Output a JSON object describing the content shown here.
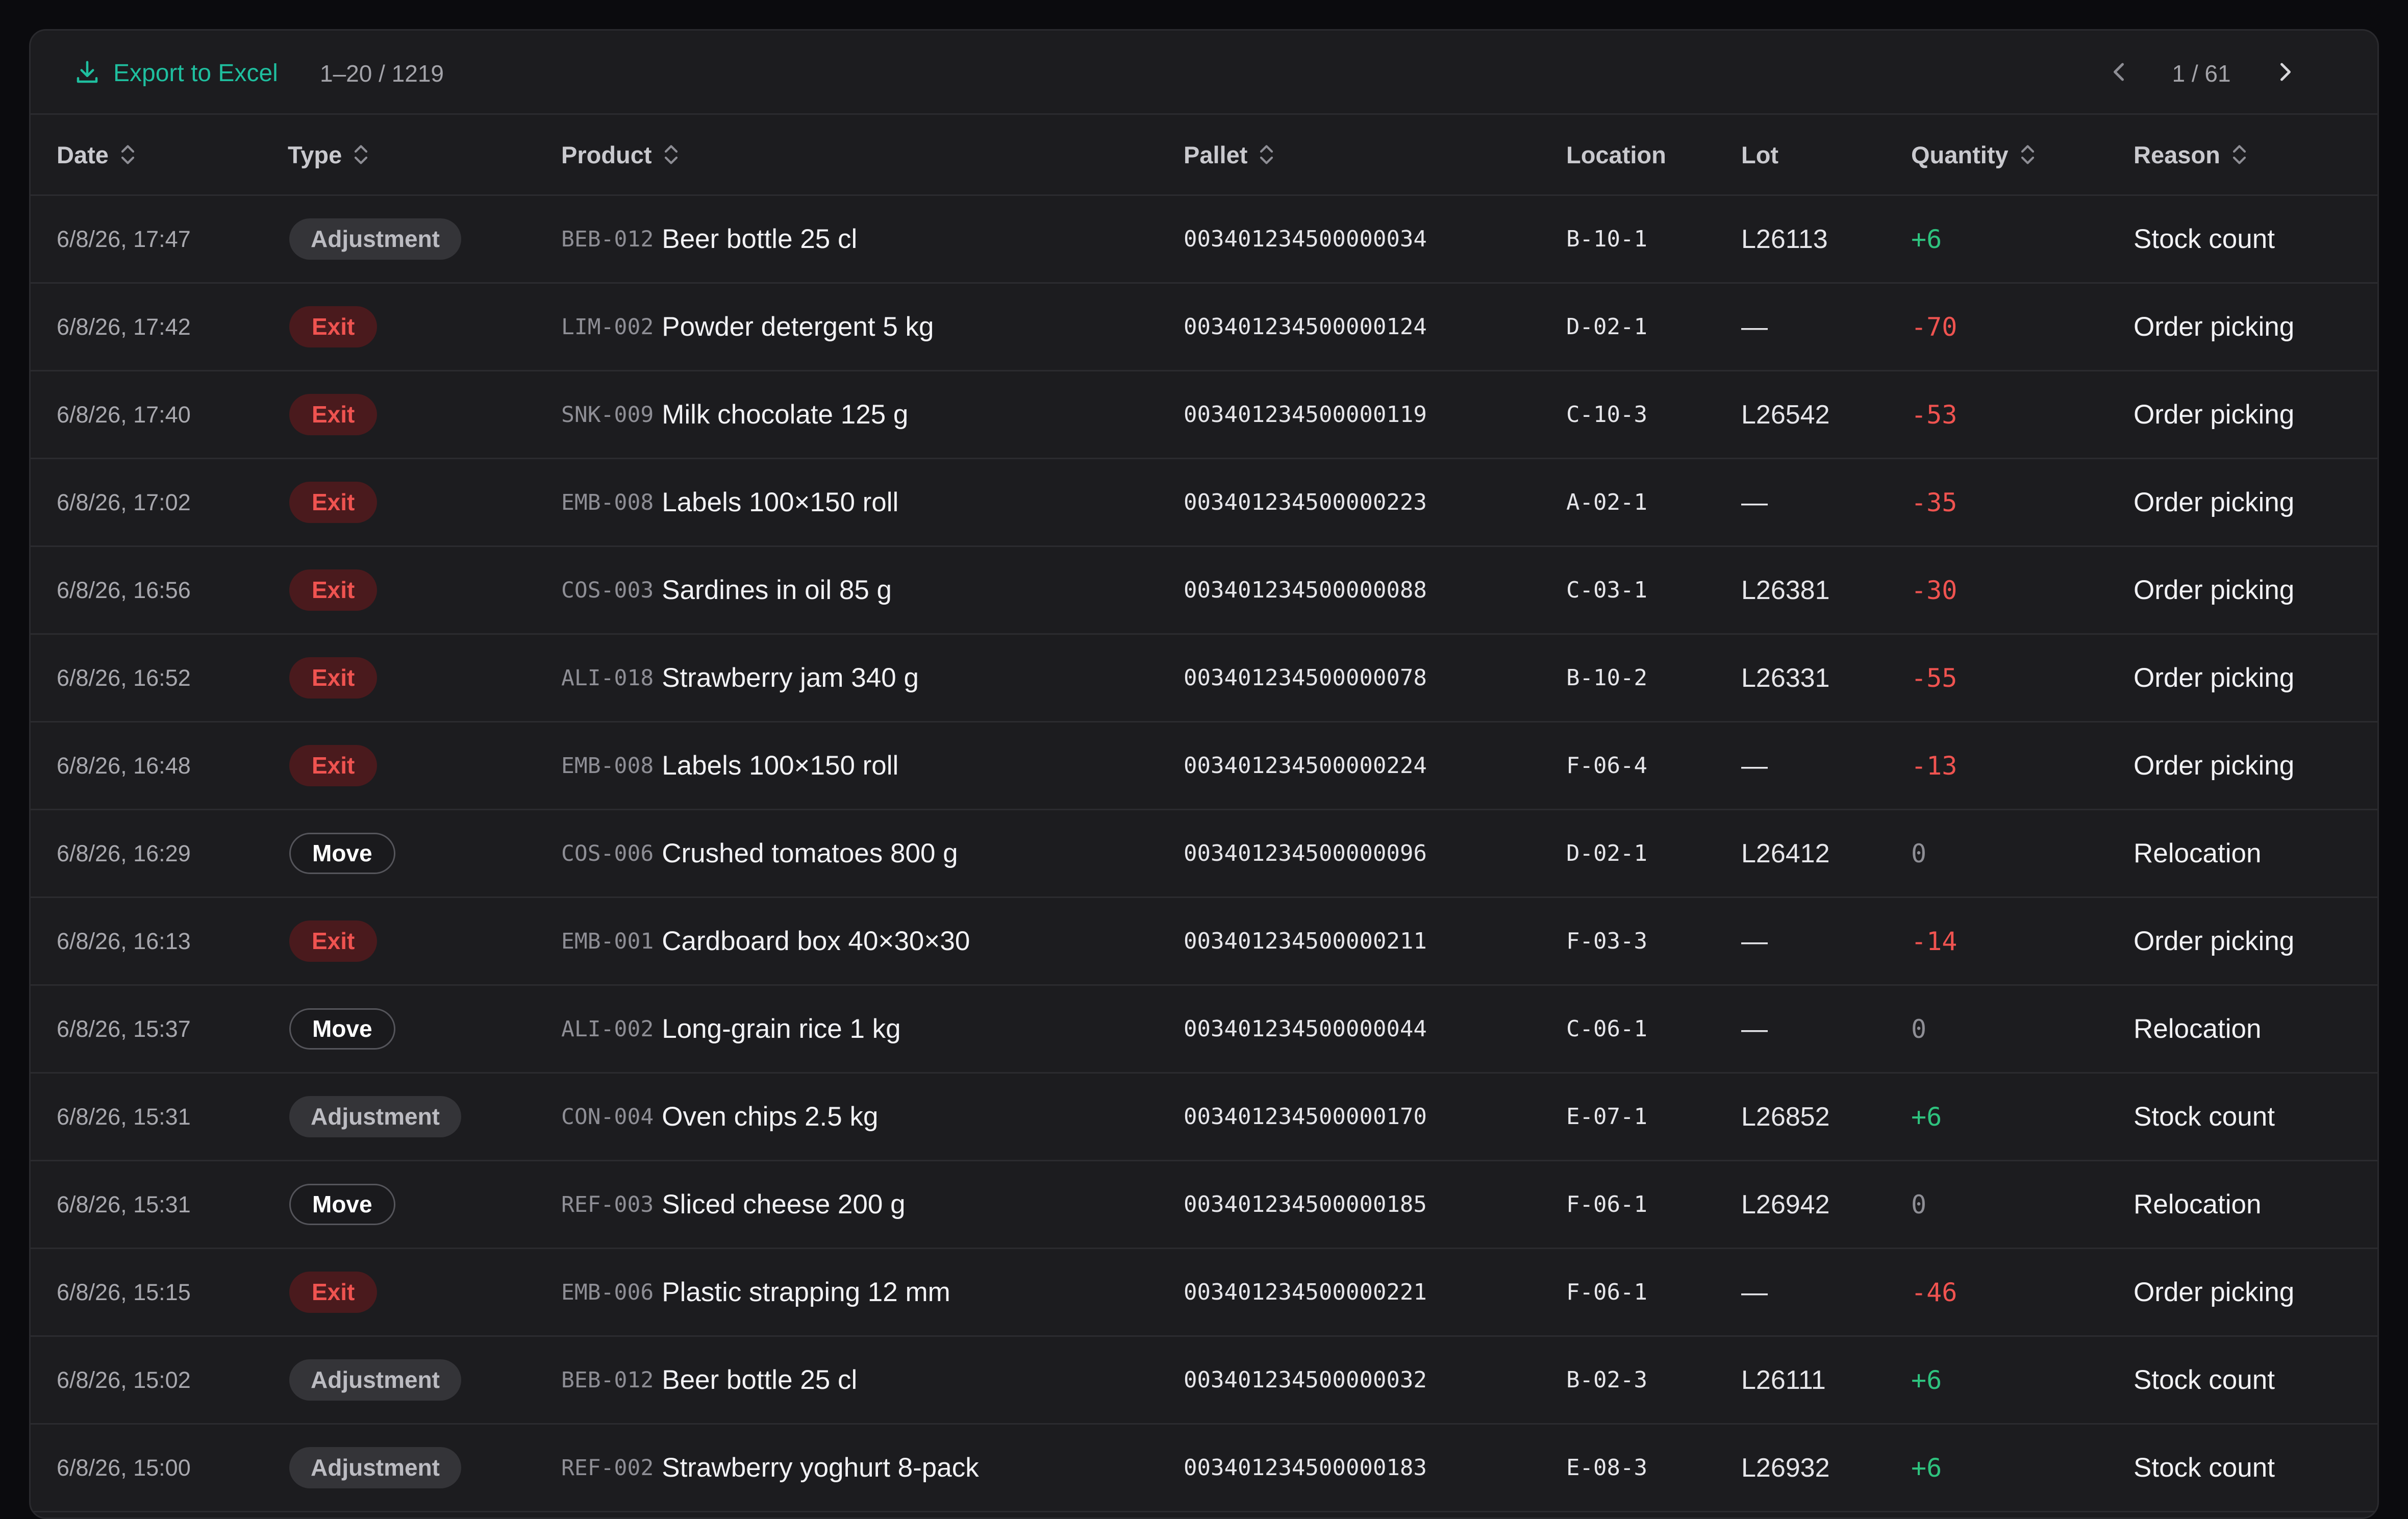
{
  "toolbar": {
    "export_label": "Export to Excel",
    "range_text": "1–20 / 1219",
    "page_text": "1 / 61"
  },
  "colors": {
    "accent": "#1fbf9f",
    "positive": "#2ec27e",
    "negative": "#ef5350",
    "background": "#1c1c1f"
  },
  "icons": {
    "export": "download-icon",
    "prev": "chevron-left-icon",
    "next": "chevron-right-icon",
    "sort": "sort-updown-icon"
  },
  "columns": [
    {
      "key": "date",
      "label": "Date",
      "sortable": true
    },
    {
      "key": "type",
      "label": "Type",
      "sortable": true
    },
    {
      "key": "product",
      "label": "Product",
      "sortable": true
    },
    {
      "key": "pallet",
      "label": "Pallet",
      "sortable": true
    },
    {
      "key": "location",
      "label": "Location",
      "sortable": false
    },
    {
      "key": "lot",
      "label": "Lot",
      "sortable": false
    },
    {
      "key": "quantity",
      "label": "Quantity",
      "sortable": true
    },
    {
      "key": "reason",
      "label": "Reason",
      "sortable": true
    }
  ],
  "rows": [
    {
      "date": "6/8/26, 17:47",
      "type": "Adjustment",
      "code": "BEB-012",
      "product": "Beer bottle 25 cl",
      "pallet": "003401234500000034",
      "location": "B-10-1",
      "lot": "L26113",
      "quantity": "+6",
      "reason": "Stock count"
    },
    {
      "date": "6/8/26, 17:42",
      "type": "Exit",
      "code": "LIM-002",
      "product": "Powder detergent 5 kg",
      "pallet": "003401234500000124",
      "location": "D-02-1",
      "lot": "—",
      "quantity": "-70",
      "reason": "Order picking"
    },
    {
      "date": "6/8/26, 17:40",
      "type": "Exit",
      "code": "SNK-009",
      "product": "Milk chocolate 125 g",
      "pallet": "003401234500000119",
      "location": "C-10-3",
      "lot": "L26542",
      "quantity": "-53",
      "reason": "Order picking"
    },
    {
      "date": "6/8/26, 17:02",
      "type": "Exit",
      "code": "EMB-008",
      "product": "Labels 100×150 roll",
      "pallet": "003401234500000223",
      "location": "A-02-1",
      "lot": "—",
      "quantity": "-35",
      "reason": "Order picking"
    },
    {
      "date": "6/8/26, 16:56",
      "type": "Exit",
      "code": "COS-003",
      "product": "Sardines in oil 85 g",
      "pallet": "003401234500000088",
      "location": "C-03-1",
      "lot": "L26381",
      "quantity": "-30",
      "reason": "Order picking"
    },
    {
      "date": "6/8/26, 16:52",
      "type": "Exit",
      "code": "ALI-018",
      "product": "Strawberry jam 340 g",
      "pallet": "003401234500000078",
      "location": "B-10-2",
      "lot": "L26331",
      "quantity": "-55",
      "reason": "Order picking"
    },
    {
      "date": "6/8/26, 16:48",
      "type": "Exit",
      "code": "EMB-008",
      "product": "Labels 100×150 roll",
      "pallet": "003401234500000224",
      "location": "F-06-4",
      "lot": "—",
      "quantity": "-13",
      "reason": "Order picking"
    },
    {
      "date": "6/8/26, 16:29",
      "type": "Move",
      "code": "COS-006",
      "product": "Crushed tomatoes 800 g",
      "pallet": "003401234500000096",
      "location": "D-02-1",
      "lot": "L26412",
      "quantity": "0",
      "reason": "Relocation"
    },
    {
      "date": "6/8/26, 16:13",
      "type": "Exit",
      "code": "EMB-001",
      "product": "Cardboard box 40×30×30",
      "pallet": "003401234500000211",
      "location": "F-03-3",
      "lot": "—",
      "quantity": "-14",
      "reason": "Order picking"
    },
    {
      "date": "6/8/26, 15:37",
      "type": "Move",
      "code": "ALI-002",
      "product": "Long-grain rice 1 kg",
      "pallet": "003401234500000044",
      "location": "C-06-1",
      "lot": "—",
      "quantity": "0",
      "reason": "Relocation"
    },
    {
      "date": "6/8/26, 15:31",
      "type": "Adjustment",
      "code": "CON-004",
      "product": "Oven chips 2.5 kg",
      "pallet": "003401234500000170",
      "location": "E-07-1",
      "lot": "L26852",
      "quantity": "+6",
      "reason": "Stock count"
    },
    {
      "date": "6/8/26, 15:31",
      "type": "Move",
      "code": "REF-003",
      "product": "Sliced cheese 200 g",
      "pallet": "003401234500000185",
      "location": "F-06-1",
      "lot": "L26942",
      "quantity": "0",
      "reason": "Relocation"
    },
    {
      "date": "6/8/26, 15:15",
      "type": "Exit",
      "code": "EMB-006",
      "product": "Plastic strapping 12 mm",
      "pallet": "003401234500000221",
      "location": "F-06-1",
      "lot": "—",
      "quantity": "-46",
      "reason": "Order picking"
    },
    {
      "date": "6/8/26, 15:02",
      "type": "Adjustment",
      "code": "BEB-012",
      "product": "Beer bottle 25 cl",
      "pallet": "003401234500000032",
      "location": "B-02-3",
      "lot": "L26111",
      "quantity": "+6",
      "reason": "Stock count"
    },
    {
      "date": "6/8/26, 15:00",
      "type": "Adjustment",
      "code": "REF-002",
      "product": "Strawberry yoghurt 8-pack",
      "pallet": "003401234500000183",
      "location": "E-08-3",
      "lot": "L26932",
      "quantity": "+6",
      "reason": "Stock count"
    }
  ]
}
